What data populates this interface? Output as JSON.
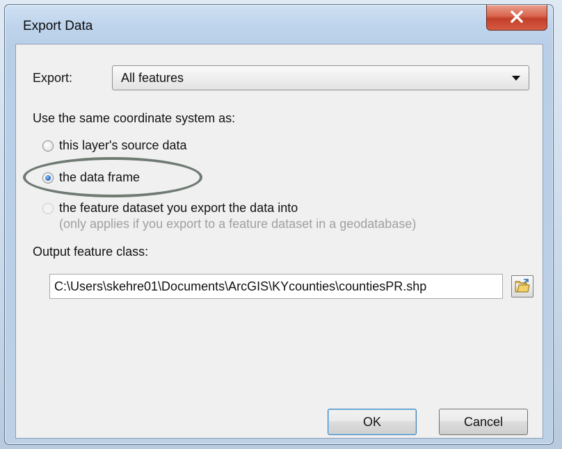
{
  "window": {
    "title": "Export Data"
  },
  "export": {
    "label": "Export:",
    "selected": "All features"
  },
  "coord": {
    "heading": "Use the same coordinate system as:",
    "options": [
      {
        "label": "this layer's source data",
        "checked": false,
        "enabled": true
      },
      {
        "label": "the data frame",
        "checked": true,
        "enabled": true
      },
      {
        "label": "the feature dataset you export the data into",
        "sub": "(only applies if you export to a feature dataset in a geodatabase)",
        "checked": false,
        "enabled": false
      }
    ]
  },
  "output": {
    "label": "Output feature class:",
    "path": "C:\\Users\\skehre01\\Documents\\ArcGIS\\KYcounties\\countiesPR.shp"
  },
  "buttons": {
    "ok": "OK",
    "cancel": "Cancel"
  },
  "icons": {
    "close": "close-icon",
    "browse": "open-folder-icon"
  },
  "colors": {
    "close_button": "#c2402a",
    "highlight_ellipse": "#6f7a73",
    "radio_checked": "#2d72c9"
  }
}
